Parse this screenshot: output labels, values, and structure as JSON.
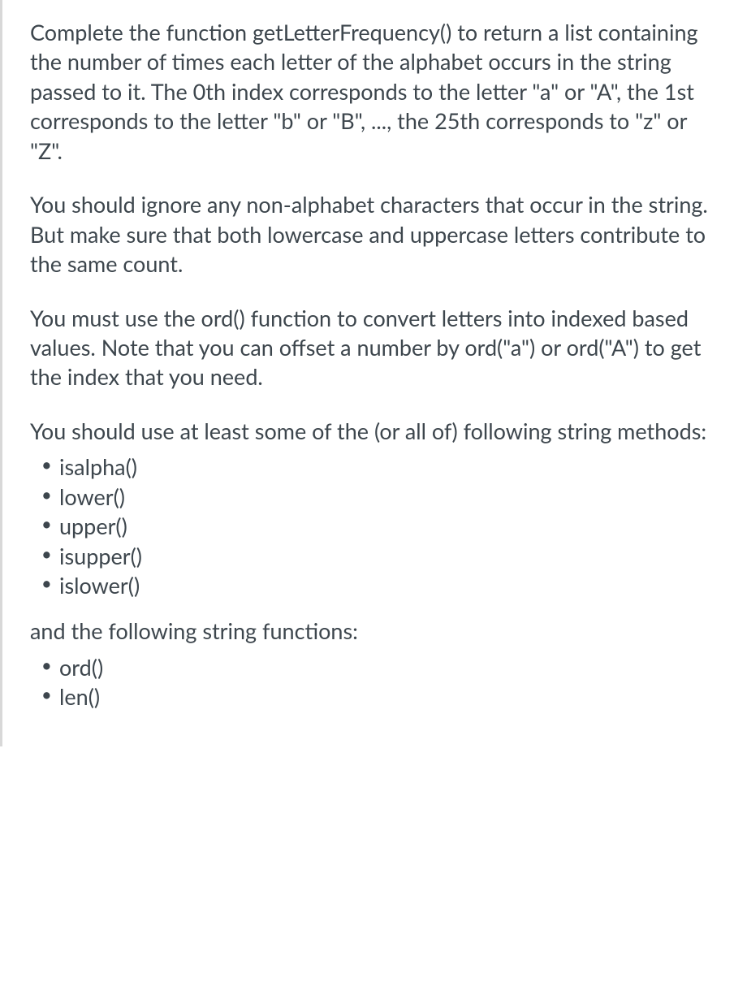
{
  "paragraphs": {
    "p1": "Complete the function getLetterFrequency() to return a list containing the number of times each letter of the alphabet occurs in the string passed to it. The 0th index corresponds to the letter \"a\" or \"A\", the 1st corresponds to the letter \"b\" or \"B\", ..., the 25th corresponds to \"z\" or \"Z\".",
    "p2": "You should ignore any non-alphabet characters that occur in the string. But make sure that both lowercase and uppercase letters contribute to the same count.",
    "p3": "You must use the ord() function to convert letters into indexed based values. Note that you can offset a number by ord(\"a\") or ord(\"A\") to get the index that you need.",
    "p4": "You should use at least some of the (or all of) following string methods:",
    "p5": "and the following string functions:"
  },
  "list1": {
    "items": [
      "isalpha()",
      "lower()",
      "upper()",
      "isupper()",
      "islower()"
    ]
  },
  "list2": {
    "items": [
      "ord()",
      "len()"
    ]
  }
}
